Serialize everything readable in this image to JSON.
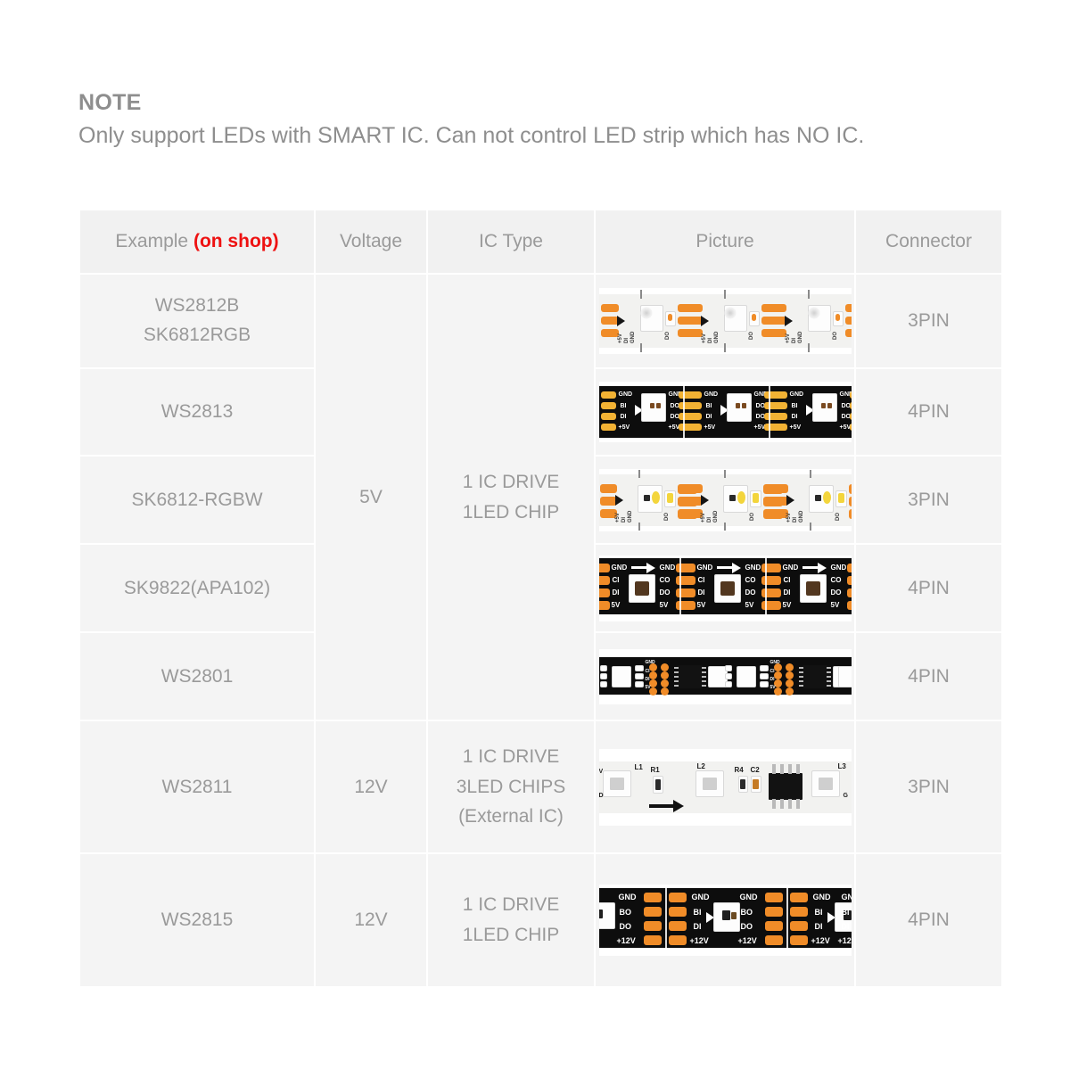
{
  "note": {
    "title": "NOTE",
    "body": "Only support LEDs with SMART IC. Can not control LED strip which has NO IC."
  },
  "table": {
    "headers": {
      "example": "Example ",
      "example_highlight": "(on shop)",
      "voltage": "Voltage",
      "ic_type": "IC Type",
      "picture": "Picture",
      "connector": "Connector"
    },
    "highlight_color": "#ee1111",
    "rows": [
      {
        "example_line1": "WS2812B",
        "example_line2": "SK6812RGB",
        "connector": "3PIN",
        "strip": "ws2812b"
      },
      {
        "example_line1": "WS2813",
        "example_line2": "",
        "connector": "4PIN",
        "strip": "ws2813"
      },
      {
        "example_line1": "SK6812-RGBW",
        "example_line2": "",
        "connector": "3PIN",
        "strip": "sk6812rgbw"
      },
      {
        "example_line1": "SK9822(APA102)",
        "example_line2": "",
        "connector": "4PIN",
        "strip": "sk9822"
      },
      {
        "example_line1": "WS2801",
        "example_line2": "",
        "connector": "4PIN",
        "strip": "ws2801"
      },
      {
        "example_line1": "WS2811",
        "example_line2": "",
        "connector": "3PIN",
        "strip": "ws2811"
      },
      {
        "example_line1": "WS2815",
        "example_line2": "",
        "connector": "4PIN",
        "strip": "ws2815"
      }
    ],
    "voltage_groups": [
      {
        "value": "5V",
        "rowspan": 5
      },
      {
        "value": "12V",
        "rowspan": 1
      },
      {
        "value": "12V",
        "rowspan": 1
      }
    ],
    "ictype_groups": [
      {
        "line1": "1 IC DRIVE",
        "line2": "1LED CHIP",
        "line3": "",
        "rowspan": 5
      },
      {
        "line1": "1 IC DRIVE",
        "line2": "3LED CHIPS",
        "line3": "(External IC)",
        "rowspan": 1
      },
      {
        "line1": "1 IC DRIVE",
        "line2": "1LED CHIP",
        "line3": "",
        "rowspan": 1
      }
    ]
  },
  "strip_labels": {
    "ws2812b": [
      "GND",
      "DI",
      "DO",
      "+5V"
    ],
    "ws2813": {
      "left": [
        "GND",
        "BI",
        "DI",
        "+5V"
      ],
      "right": [
        "GND",
        "DO",
        "DO",
        "+5V"
      ]
    },
    "sk6812rgbw": [
      "GND",
      "DI",
      "DO",
      "+5V"
    ],
    "sk9822": {
      "left": [
        "GND",
        "CI",
        "DI",
        "5V"
      ],
      "right": [
        "GND",
        "CO",
        "DO",
        "5V"
      ]
    },
    "ws2801": [
      "GND",
      "CI",
      "DI",
      "5V"
    ],
    "ws2811": [
      "L1",
      "L2",
      "L3",
      "R1",
      "R4",
      "C2"
    ],
    "ws2815": {
      "left": [
        "GND",
        "BO",
        "DO",
        "+12V"
      ],
      "right": [
        "GND",
        "BI",
        "DI",
        "+12V"
      ]
    }
  }
}
